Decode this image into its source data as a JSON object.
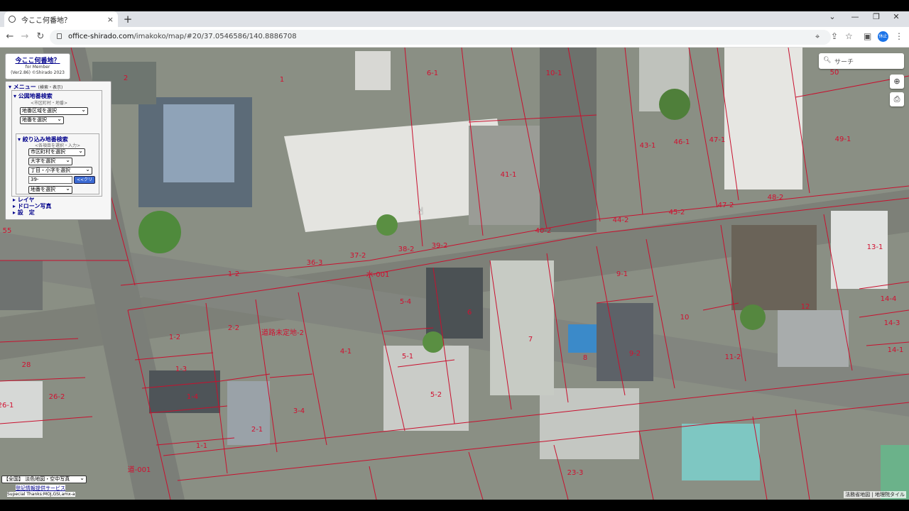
{
  "browser": {
    "tab_title": "今ここ何番地？",
    "tab_close": "×",
    "new_tab": "+",
    "url_host": "office-shirado.com",
    "url_path": "/imakoko/map/#20/37.0546586/140.8886708",
    "profile_label": "休止"
  },
  "panel": {
    "title": "今ここ何番地？",
    "subtitle": "for Member",
    "version": "(Ver2.86) ©Shirado 2023",
    "menu_header": "▾ メニュー",
    "menu_header_note": "(検索・表示)",
    "public_search": "▾ 公図地番検索",
    "public_search_note": "<市区町村・地番>",
    "select_area": "地番区域を選択",
    "select_lot": "地番を選択",
    "narrow_search": "▾ 絞り込み地番検索",
    "narrow_note": "<各項目を選択・入力>",
    "select_city": "市区町村を選択",
    "select_oaza": "大字を選択",
    "select_chome": "丁目・小字を選択",
    "lot_input": "39-",
    "clear_button": "<<クリア",
    "select_lot2": "地番を選択",
    "layer": "▸ レイヤ",
    "drone": "▸ ドローン写真",
    "settings": "▸ 設　定"
  },
  "search": {
    "placeholder": "サーチ"
  },
  "bottom_left": {
    "basemap_select": "【全国】 淡色地図・空中写真",
    "registry_link": "登記情報提供サービス",
    "thanks": "Supecial Thanks:MOJ,GSI,amx-a"
  },
  "attribution": "法務省地図 | 地理院タイル",
  "parcels": [
    "1",
    "2",
    "6-1",
    "10-1",
    "50",
    "49-1",
    "43-1",
    "46-1",
    "47-1",
    "41-1",
    "48-2",
    "44-2",
    "45-2",
    "47-2",
    "40-2",
    "55",
    "36-3",
    "37-2",
    "38-2",
    "39-2",
    "1-2",
    "水-001",
    "9-1",
    "13-1",
    "14-4",
    "5-4",
    "6",
    "10",
    "12",
    "14-3",
    "1-2",
    "2-2",
    "道路未定地-2",
    "4-1",
    "7",
    "5-1",
    "8",
    "9-2",
    "11-2",
    "14-1",
    "28",
    "1-3",
    "26-2",
    "26-1",
    "1-4",
    "3-4",
    "5-2",
    "2-1",
    "1-1",
    "道-001",
    "23-3"
  ],
  "colors": {
    "parcel_line": "#c8102e",
    "parcel_label": "#d11030"
  }
}
